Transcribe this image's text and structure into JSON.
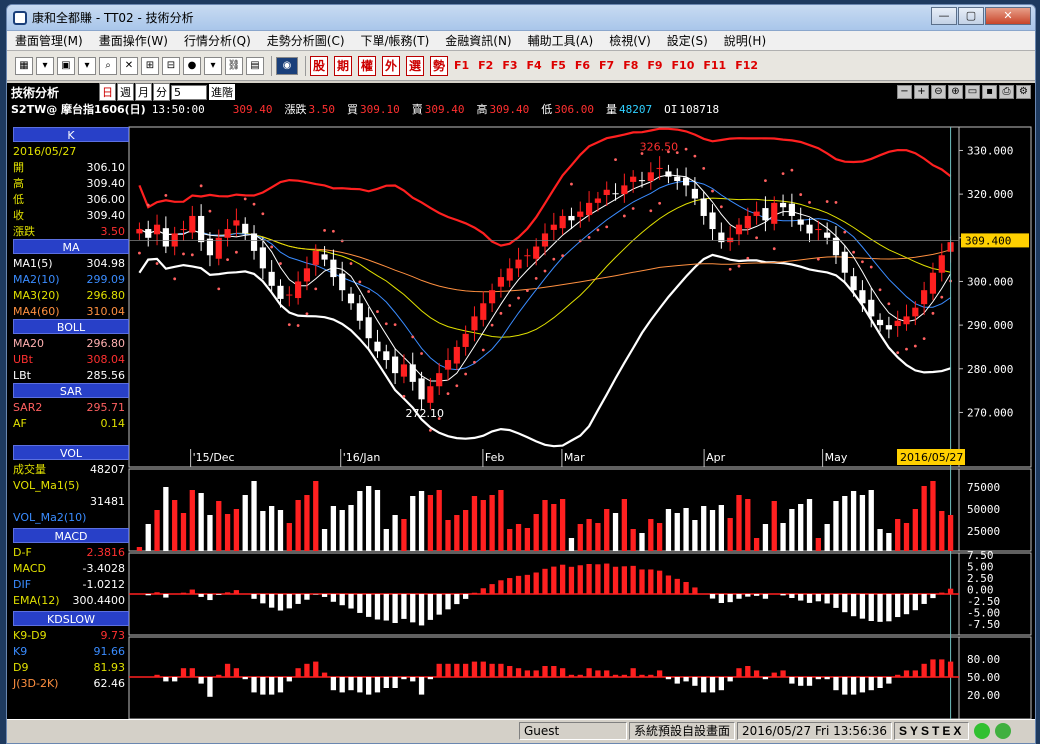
{
  "window": {
    "title": "康和全都賺 - TT02 - 技術分析",
    "min": "—",
    "max": "▢",
    "close": "✕"
  },
  "menu": [
    "畫面管理(M)",
    "畫面操作(W)",
    "行情分析(Q)",
    "走勢分析圖(C)",
    "下單/帳務(T)",
    "金融資訊(N)",
    "輔助工具(A)",
    "檢視(V)",
    "設定(S)",
    "說明(H)"
  ],
  "toolbar": {
    "red_buttons": [
      "股",
      "期",
      "權",
      "外",
      "選",
      "勢"
    ],
    "fkeys": [
      "F1",
      "F2",
      "F3",
      "F4",
      "F5",
      "F6",
      "F7",
      "F8",
      "F9",
      "F10",
      "F11",
      "F12"
    ]
  },
  "header": {
    "title": "技術分析",
    "periods": [
      "日",
      "週",
      "月",
      "分"
    ],
    "active_period": "日",
    "minute_value": "5",
    "advanced": "進階",
    "symbol": "S2TW@ 摩台指1606(日)",
    "time": "13:50:00",
    "price": "309.40",
    "change_label": "漲跌",
    "change": "3.50",
    "bid_label": "買",
    "bid": "309.10",
    "ask_label": "賣",
    "ask": "309.40",
    "high_label": "高",
    "high": "309.40",
    "low_label": "低",
    "low": "306.00",
    "vol_label": "量",
    "vol": "48207",
    "oi_label": "OI",
    "oi": "108718"
  },
  "legend": {
    "k": {
      "title": "K",
      "date": "2016/05/27",
      "rows": [
        [
          "開",
          "306.10"
        ],
        [
          "高",
          "309.40"
        ],
        [
          "低",
          "306.00"
        ],
        [
          "收",
          "309.40"
        ],
        [
          "漲跌",
          "3.50"
        ]
      ]
    },
    "ma": {
      "title": "MA",
      "rows": [
        [
          "MA1(5)",
          "304.98"
        ],
        [
          "MA2(10)",
          "299.09"
        ],
        [
          "MA3(20)",
          "296.80"
        ],
        [
          "MA4(60)",
          "310.04"
        ]
      ]
    },
    "boll": {
      "title": "BOLL",
      "rows": [
        [
          "MA20",
          "296.80"
        ],
        [
          "UBt",
          "308.04"
        ],
        [
          "LBt",
          "285.56"
        ]
      ]
    },
    "sar": {
      "title": "SAR",
      "rows": [
        [
          "SAR2",
          "295.71"
        ],
        [
          "AF",
          "0.14"
        ]
      ]
    },
    "vol": {
      "title": "VOL",
      "rows": [
        [
          "成交量",
          "48207"
        ],
        [
          "VOL_Ma1(5)",
          "31481"
        ],
        [
          "VOL_Ma2(10)",
          ""
        ]
      ]
    },
    "macd": {
      "title": "MACD",
      "rows": [
        [
          "D-F",
          "2.3816"
        ],
        [
          "MACD",
          "-3.4028"
        ],
        [
          "DIF",
          "-1.0212"
        ],
        [
          "EMA(12)",
          "300.4400"
        ]
      ]
    },
    "kd": {
      "title": "KDSLOW",
      "rows": [
        [
          "K9-D9",
          "9.73"
        ],
        [
          "K9",
          "91.66"
        ],
        [
          "D9",
          "81.93"
        ],
        [
          "J(3D-2K)",
          "62.46"
        ]
      ]
    }
  },
  "colors": {
    "k_up": "#ff2020",
    "k_down": "#ffffff",
    "ma1": "#ffffff",
    "ma2": "#3a8cff",
    "ma3": "#e0e000",
    "ma4": "#ff9040",
    "boll": "#ff2020",
    "sar": "#ff6060"
  },
  "chart_data": {
    "type": "candlestick",
    "price_ticks": [
      "330.000",
      "320.000",
      "310.000",
      "300.000",
      "290.000",
      "280.000",
      "270.000"
    ],
    "price_range": [
      263,
      334
    ],
    "last_price_label": "309.400",
    "x_labels": [
      "'15/Dec",
      "'16/Jan",
      "Feb",
      "Mar",
      "Apr",
      "May"
    ],
    "cursor_date": "2016/05/27",
    "annotations": {
      "high": "326.50",
      "low": "272.10"
    },
    "vol_ticks": [
      "75000",
      "50000",
      "25000"
    ],
    "macd_ticks": [
      "7.50",
      "5.00",
      "2.50",
      "0.00",
      "-2.50",
      "-5.00",
      "-7.50"
    ],
    "kd_ticks": [
      "80.00",
      "50.00",
      "20.00"
    ],
    "closes": [
      312,
      310,
      313,
      308,
      311,
      312,
      315,
      309,
      306,
      310,
      312,
      314,
      311,
      307,
      303,
      299,
      296,
      297,
      300,
      303,
      307,
      305,
      301,
      298,
      295,
      291,
      287,
      284,
      282,
      279,
      281,
      277,
      273,
      276,
      279,
      282,
      285,
      288,
      292,
      295,
      298,
      301,
      303,
      305,
      306,
      308,
      311,
      313,
      315,
      314,
      316,
      318,
      319,
      321,
      320,
      322,
      324,
      323,
      325,
      326,
      324,
      323,
      322,
      319,
      315,
      312,
      309,
      310,
      313,
      315,
      316,
      314,
      318,
      317,
      315,
      313,
      311,
      312,
      310,
      306,
      302,
      298,
      295,
      292,
      290,
      289,
      291,
      292,
      294,
      298,
      302,
      306,
      309
    ]
  },
  "status": {
    "user": "Guest",
    "screen": "系統預設自設畫面",
    "datetime": "2016/05/27 Fri 13:56:36",
    "brand": "SYSTEX"
  }
}
